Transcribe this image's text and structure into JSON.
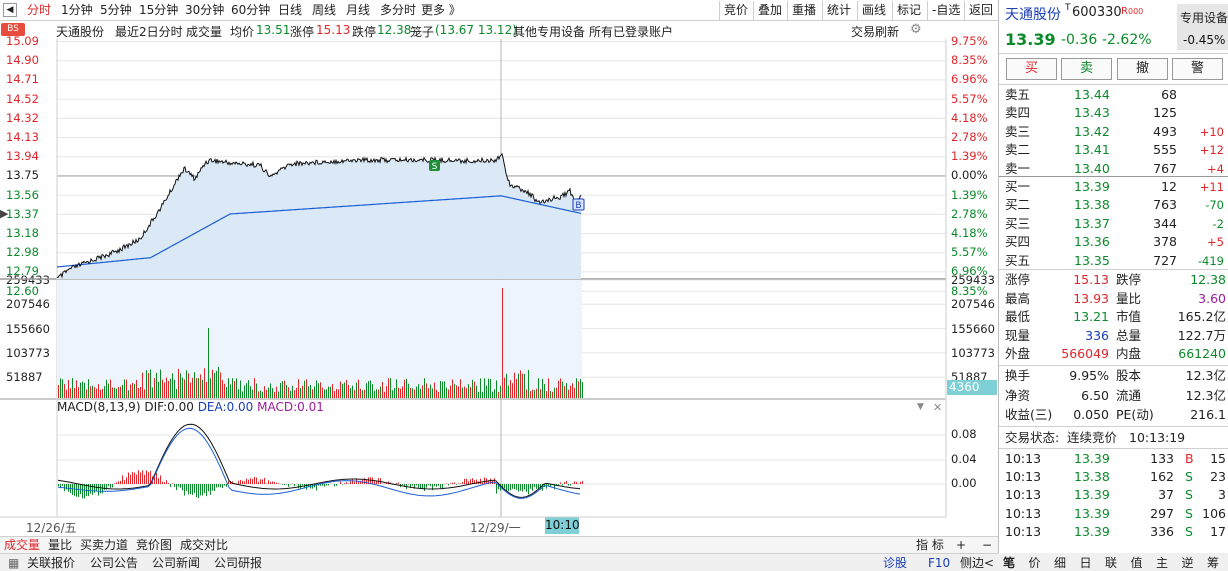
{
  "top_tabs": [
    "分时",
    "1分钟",
    "5分钟",
    "15分钟",
    "30分钟",
    "60分钟",
    "日线",
    "周线",
    "月线",
    "多分时",
    "更多 》"
  ],
  "top_right_buttons": [
    "竞价",
    "叠加",
    "重播",
    "统计",
    "画线",
    "标记",
    "-自选",
    "返回"
  ],
  "info": {
    "name": "天通股份",
    "period": "最近2日分时",
    "volume_label": "成交量",
    "avg_label": "均价",
    "avg_value": "13.51",
    "limit_up_label": "涨停",
    "limit_up_value": "15.13",
    "limit_down_label": "跌停",
    "limit_down_value": "12.38",
    "cage_label": "笼子",
    "cage_value": "(13.67 13.12)",
    "sector": "其他专用设备",
    "account": "所有已登录账户",
    "refresh": "交易刷新",
    "bs_badge": "BS"
  },
  "price_axis_left": [
    "15.09",
    "14.90",
    "14.71",
    "14.52",
    "14.32",
    "14.13",
    "13.94",
    "13.75",
    "13.56",
    "13.37",
    "13.18",
    "12.98",
    "12.79",
    "12.60"
  ],
  "price_axis_right": [
    "9.75%",
    "8.35%",
    "6.96%",
    "5.57%",
    "4.18%",
    "2.78%",
    "1.39%",
    "0.00%",
    "1.39%",
    "2.78%",
    "4.18%",
    "5.57%",
    "6.96%",
    "8.35%"
  ],
  "vol_axis_left": [
    "259433",
    "207546",
    "155660",
    "103773",
    "51887"
  ],
  "vol_axis_right": [
    "259433",
    "207546",
    "155660",
    "103773",
    "51887"
  ],
  "vol_current": "4360",
  "macd": {
    "title": "MACD(8,13,9)",
    "dif_label": "DIF:",
    "dif": "0.00",
    "dea_label": "DEA:",
    "dea": "0.00",
    "macd_label": "MACD:",
    "macd": "0.01",
    "axis": [
      "0.08",
      "0.04",
      "0.00"
    ]
  },
  "date_labels": {
    "d1": "12/26/五",
    "d2": "12/29/一",
    "cursor": "10:10"
  },
  "markers": {
    "s": "S",
    "b": "B"
  },
  "bottom_tabs": [
    "成交量",
    "量比",
    "买卖力道",
    "竞价图",
    "成交对比"
  ],
  "bottom_right": {
    "index": "指 标",
    "plus": "+",
    "minus": "−"
  },
  "status_bar": [
    "关联报价",
    "公司公告",
    "公司新闻",
    "公司研报"
  ],
  "status_right": {
    "diag": "诊股",
    "f10": "F10",
    "side": "侧边<"
  },
  "stock": {
    "name": "天通股份",
    "t_mark": "T",
    "code": "600330",
    "r_mark": "R",
    "r_code": "000",
    "tag": "专用设备",
    "price": "13.39",
    "change": "-0.36",
    "pct": "-2.62%",
    "tag_pct": "-0.45%"
  },
  "trade_buttons": [
    "买",
    "卖",
    "撤",
    "警"
  ],
  "asks": [
    {
      "label": "卖五",
      "price": "13.44",
      "vol": "68",
      "chg": ""
    },
    {
      "label": "卖四",
      "price": "13.43",
      "vol": "125",
      "chg": ""
    },
    {
      "label": "卖三",
      "price": "13.42",
      "vol": "493",
      "chg": "+10"
    },
    {
      "label": "卖二",
      "price": "13.41",
      "vol": "555",
      "chg": "+12"
    },
    {
      "label": "卖一",
      "price": "13.40",
      "vol": "767",
      "chg": "+4"
    }
  ],
  "bids": [
    {
      "label": "买一",
      "price": "13.39",
      "vol": "12",
      "chg": "+11"
    },
    {
      "label": "买二",
      "price": "13.38",
      "vol": "763",
      "chg": "-70"
    },
    {
      "label": "买三",
      "price": "13.37",
      "vol": "344",
      "chg": "-2"
    },
    {
      "label": "买四",
      "price": "13.36",
      "vol": "378",
      "chg": "+5"
    },
    {
      "label": "买五",
      "price": "13.35",
      "vol": "727",
      "chg": "-419"
    }
  ],
  "stats": [
    {
      "l1": "涨停",
      "v1": "15.13",
      "l2": "跌停",
      "v2": "12.38"
    },
    {
      "l1": "最高",
      "v1": "13.93",
      "l2": "量比",
      "v2": "3.60"
    },
    {
      "l1": "最低",
      "v1": "13.21",
      "l2": "市值",
      "v2": "165.2亿"
    },
    {
      "l1": "现量",
      "v1": "336",
      "l2": "总量",
      "v2": "122.7万"
    },
    {
      "l1": "外盘",
      "v1": "566049",
      "l2": "内盘",
      "v2": "661240"
    }
  ],
  "stats2": [
    {
      "l1": "换手",
      "v1": "9.95%",
      "l2": "股本",
      "v2": "12.3亿"
    },
    {
      "l1": "净资",
      "v1": "6.50",
      "l2": "流通",
      "v2": "12.3亿"
    },
    {
      "l1": "收益(三)",
      "v1": "0.050",
      "l2": "PE(动)",
      "v2": "216.1"
    }
  ],
  "trade_state": {
    "label": "交易状态:",
    "state": "连续竞价",
    "time": "10:13:19"
  },
  "ticks": [
    {
      "time": "10:13",
      "price": "13.39",
      "vol": "133",
      "bs": "B",
      "n": "15"
    },
    {
      "time": "10:13",
      "price": "13.38",
      "vol": "162",
      "bs": "S",
      "n": "23"
    },
    {
      "time": "10:13",
      "price": "13.39",
      "vol": "37",
      "bs": "S",
      "n": "3"
    },
    {
      "time": "10:13",
      "price": "13.39",
      "vol": "297",
      "bs": "S",
      "n": "106"
    },
    {
      "time": "10:13",
      "price": "13.39",
      "vol": "336",
      "bs": "S",
      "n": "17"
    }
  ],
  "right_nav": [
    "笔",
    "价",
    "细",
    "日",
    "联",
    "值",
    "主",
    "逆",
    "筹"
  ],
  "colors": {
    "up": "#e0262a",
    "down": "#0b8a2a",
    "price_line": "#111111",
    "avg_line": "#1a5fd6",
    "area_fill": "#dbe9f7"
  }
}
